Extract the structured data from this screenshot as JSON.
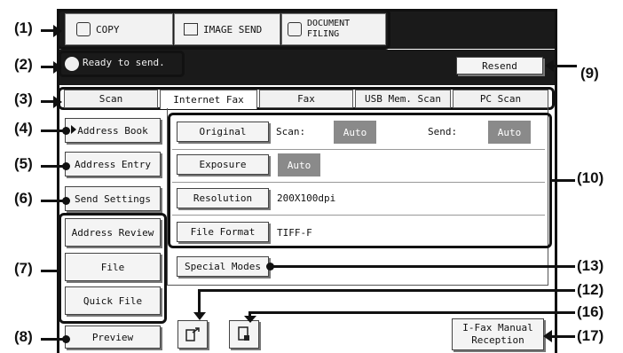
{
  "mode_tabs": [
    {
      "label": "COPY",
      "icon": "copy-icon"
    },
    {
      "label": "IMAGE SEND",
      "icon": "image-send-icon"
    },
    {
      "label": "DOCUMENT\nFILING",
      "icon": "document-filing-icon"
    }
  ],
  "status": {
    "message": "Ready to send."
  },
  "resend_label": "Resend",
  "send_tabs": [
    "Scan",
    "Internet Fax",
    "Fax",
    "USB Mem. Scan",
    "PC Scan"
  ],
  "left_buttons": {
    "address_book": "Address Book",
    "address_entry": "Address Entry",
    "send_settings": "Send Settings",
    "address_review": "Address Review",
    "file": "File",
    "quick_file": "Quick File",
    "preview": "Preview"
  },
  "settings": {
    "original_label": "Original",
    "scan_label": "Scan:",
    "scan_value": "Auto",
    "send_label": "Send:",
    "send_value": "Auto",
    "exposure_label": "Exposure",
    "exposure_value": "Auto",
    "resolution_label": "Resolution",
    "resolution_value": "200X100dpi",
    "file_format_label": "File Format",
    "file_format_value": "TIFF-F"
  },
  "special_modes_label": "Special Modes",
  "manual_reception_label": "I-Fax Manual\nReception",
  "callouts": {
    "c1": "(1)",
    "c2": "(2)",
    "c3": "(3)",
    "c4": "(4)",
    "c5": "(5)",
    "c6": "(6)",
    "c7": "(7)",
    "c8": "(8)",
    "c9": "(9)",
    "c10": "(10)",
    "c12": "(12)",
    "c13": "(13)",
    "c16": "(16)",
    "c17": "(17)"
  }
}
